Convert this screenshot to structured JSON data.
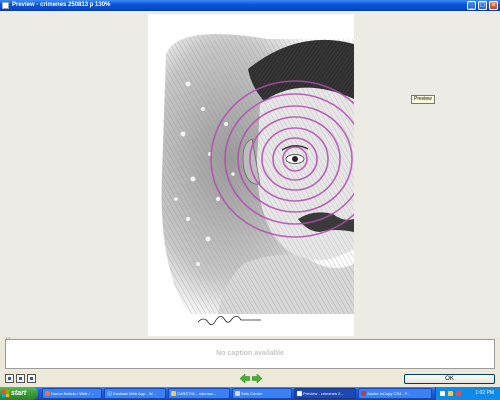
{
  "window": {
    "title": "Preview - crimenes 250813 p 130%"
  },
  "tooltip": {
    "text": "Preview"
  },
  "caption": {
    "placeholder": "No caption available"
  },
  "footer": {
    "ok_label": "OK"
  },
  "taskbar": {
    "start_label": "start",
    "tasks": [
      {
        "label": "Nueva Noticia / Web / ..."
      },
      {
        "label": "Escitask Web App - W..."
      },
      {
        "label": "CARETUL - microsc..."
      },
      {
        "label": "Sets Center"
      },
      {
        "label": "Preview - crimenes 2..."
      },
      {
        "label": "Adobe InCopy CS4 - F..."
      }
    ],
    "clock": "1:02 PM"
  }
}
